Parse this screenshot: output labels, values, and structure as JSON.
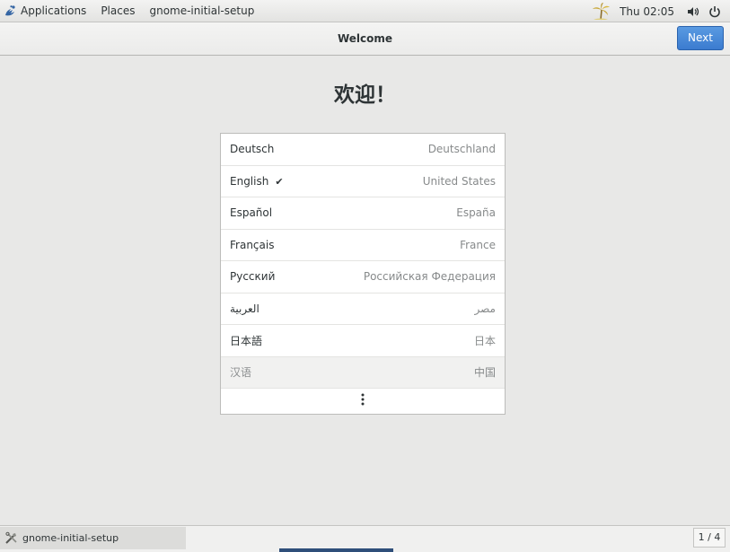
{
  "top_bar": {
    "applications_label": "Applications",
    "places_label": "Places",
    "app_name": "gnome-initial-setup",
    "clock": "Thu 02:05"
  },
  "header": {
    "title": "Welcome",
    "next_label": "Next"
  },
  "welcome_text": "欢迎！",
  "languages": [
    {
      "name": "Deutsch",
      "region": "Deutschland"
    },
    {
      "name": "English",
      "region": "United States",
      "selected": true
    },
    {
      "name": "Español",
      "region": "España"
    },
    {
      "name": "Français",
      "region": "France"
    },
    {
      "name": "Русский",
      "region": "Российская Федерация"
    },
    {
      "name": "العربية",
      "region": "مصر"
    },
    {
      "name": "日本語",
      "region": "日本"
    },
    {
      "name": "汉语",
      "region": "中国"
    }
  ],
  "check_mark": "✔",
  "taskbar": {
    "window_label": "gnome-initial-setup",
    "workspace": "1 / 4"
  },
  "icons": [
    "gnome-foot-icon",
    "palm-tree-icon",
    "volume-icon",
    "power-icon",
    "more-vertical-icon",
    "setup-tools-icon"
  ],
  "colors": {
    "accent": "#3b7bcf",
    "background": "#e8e8e7"
  }
}
